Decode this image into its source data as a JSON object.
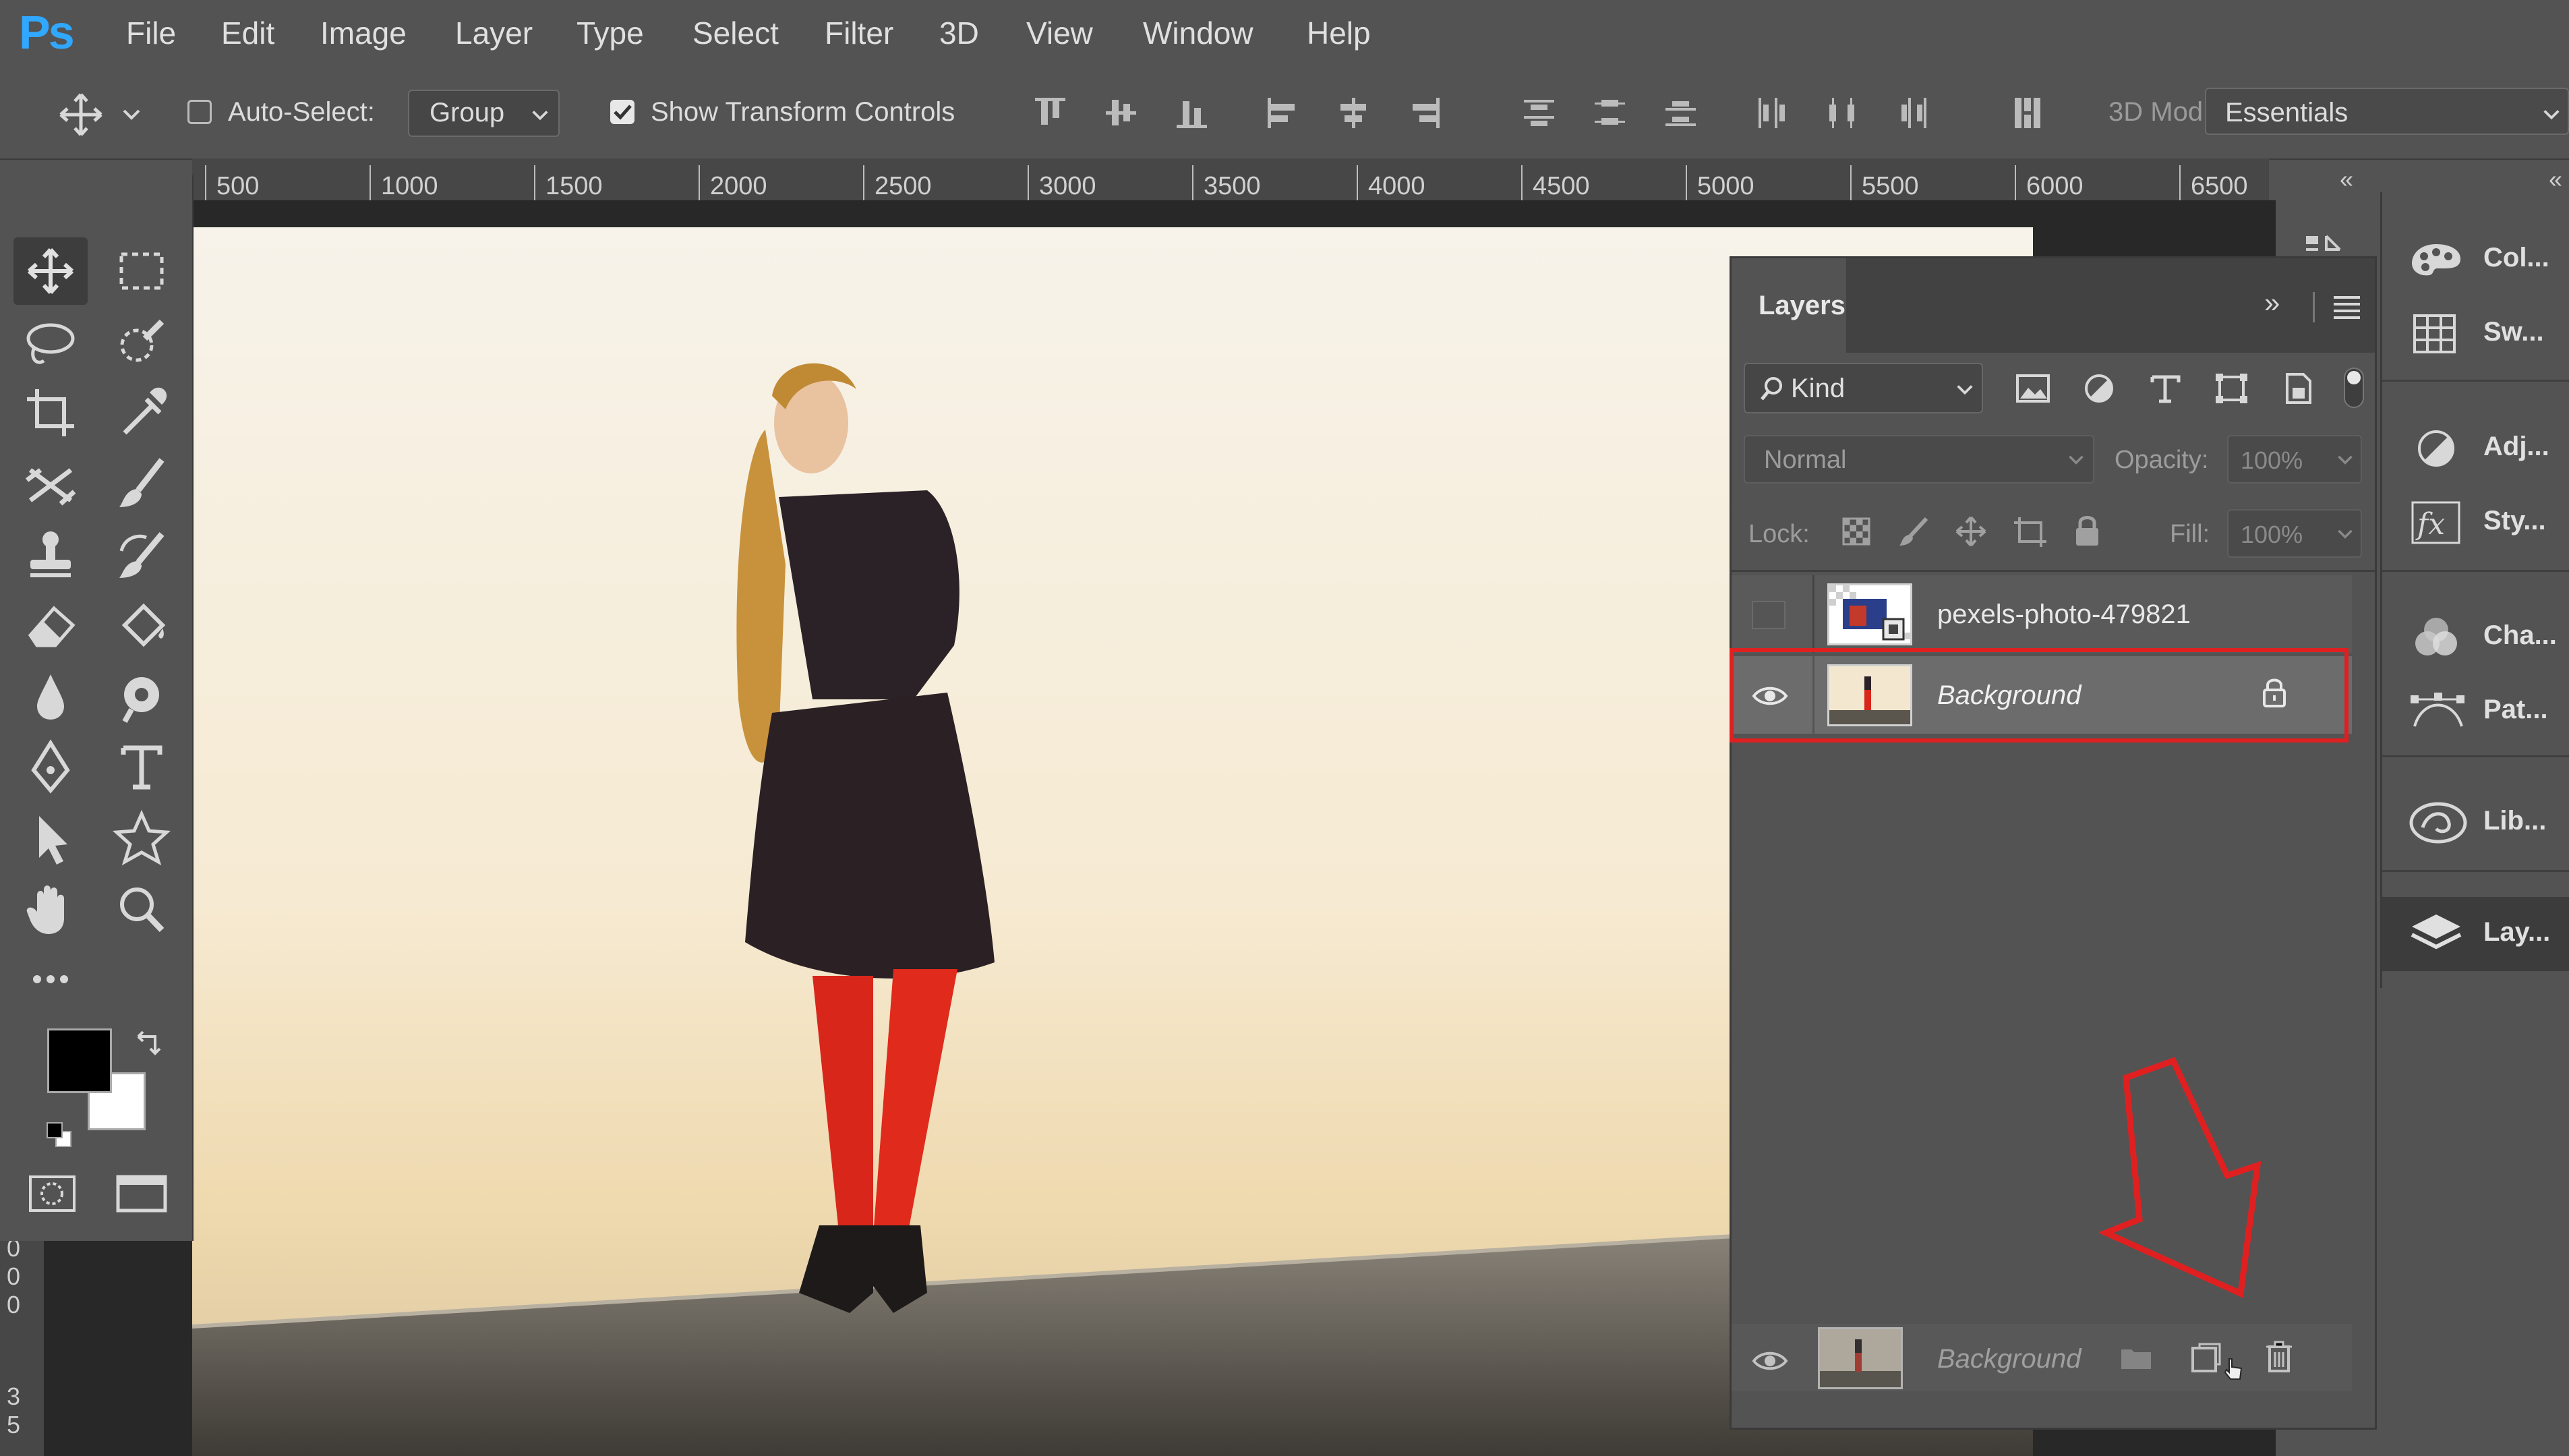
{
  "app": {
    "logo": "Ps"
  },
  "menu": [
    "File",
    "Edit",
    "Image",
    "Layer",
    "Type",
    "Select",
    "Filter",
    "3D",
    "View",
    "Window",
    "Help"
  ],
  "options_bar": {
    "auto_select_label": "Auto-Select:",
    "auto_select_checked": false,
    "group_value": "Group",
    "show_transform_label": "Show Transform Controls",
    "show_transform_checked": true,
    "mode_3d_label": "3D Mod",
    "workspace_value": "Essentials"
  },
  "ruler": {
    "ticks": [
      "500",
      "1000",
      "1500",
      "2000",
      "2500",
      "3000",
      "3500",
      "4000",
      "4500",
      "5000",
      "5500",
      "6000",
      "6500"
    ],
    "vertical_ticks": [
      "0",
      "0",
      "0",
      "3",
      "5"
    ]
  },
  "layers_panel": {
    "tab_label": "Layers",
    "filter_value": "Kind",
    "blend_mode": "Normal",
    "opacity_label": "Opacity:",
    "opacity_value": "100%",
    "lock_label": "Lock:",
    "fill_label": "Fill:",
    "fill_value": "100%",
    "layers": [
      {
        "name": "pexels-photo-479821",
        "visible": false,
        "italic": false,
        "locked": false
      },
      {
        "name": "Background",
        "visible": true,
        "italic": true,
        "locked": true,
        "highlighted": true
      }
    ],
    "drag_ghost_name": "Background",
    "highlight_color": "#e02020"
  },
  "dock": {
    "items": [
      {
        "label": "Col...",
        "icon": "palette-icon"
      },
      {
        "label": "Sw...",
        "icon": "swatches-grid-icon"
      },
      {
        "label": "Adj...",
        "icon": "adjustments-icon"
      },
      {
        "label": "Sty...",
        "icon": "fx-styles-icon"
      },
      {
        "label": "Cha...",
        "icon": "channels-icon"
      },
      {
        "label": "Pat...",
        "icon": "paths-icon"
      },
      {
        "label": "Lib...",
        "icon": "libraries-icon"
      },
      {
        "label": "Lay...",
        "icon": "layers-stack-icon"
      }
    ]
  },
  "colors": {
    "foreground": "#000000",
    "background": "#ffffff",
    "accent": "#31a8ff",
    "annotation_red": "#e02020"
  }
}
